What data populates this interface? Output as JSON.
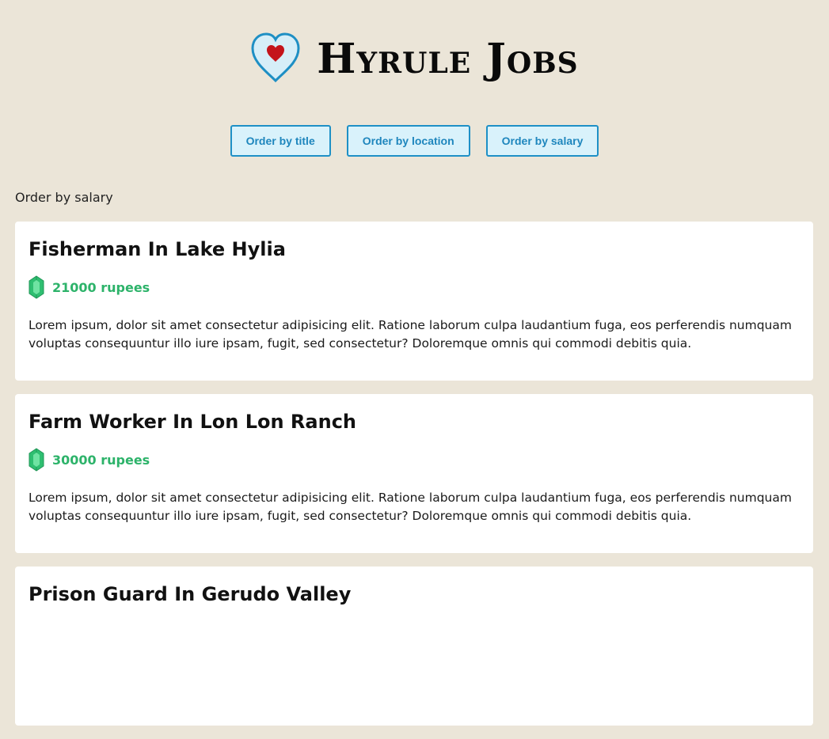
{
  "header": {
    "title": "Hyrule Jobs",
    "logo_icon": "heart-icon"
  },
  "controls": {
    "order_title": "Order by title",
    "order_location": "Order by location",
    "order_salary": "Order by salary"
  },
  "status": "Order by salary",
  "jobs": [
    {
      "title": "Fisherman In Lake Hylia",
      "salary": "21000 rupees",
      "description": "Lorem ipsum, dolor sit amet consectetur adipisicing elit. Ratione laborum culpa laudantium fuga, eos perferendis numquam voluptas consequuntur illo iure ipsam, fugit, sed consectetur? Doloremque omnis qui commodi debitis quia."
    },
    {
      "title": "Farm Worker In Lon Lon Ranch",
      "salary": "30000 rupees",
      "description": "Lorem ipsum, dolor sit amet consectetur adipisicing elit. Ratione laborum culpa laudantium fuga, eos perferendis numquam voluptas consequuntur illo iure ipsam, fugit, sed consectetur? Doloremque omnis qui commodi debitis quia."
    },
    {
      "title": "Prison Guard In Gerudo Valley",
      "salary": "",
      "description": ""
    }
  ],
  "colors": {
    "background": "#ebe5d8",
    "accent": "#1e90c6",
    "button_bg": "#d9f2fb",
    "salary": "#2db36a",
    "heart": "#c4141b"
  }
}
